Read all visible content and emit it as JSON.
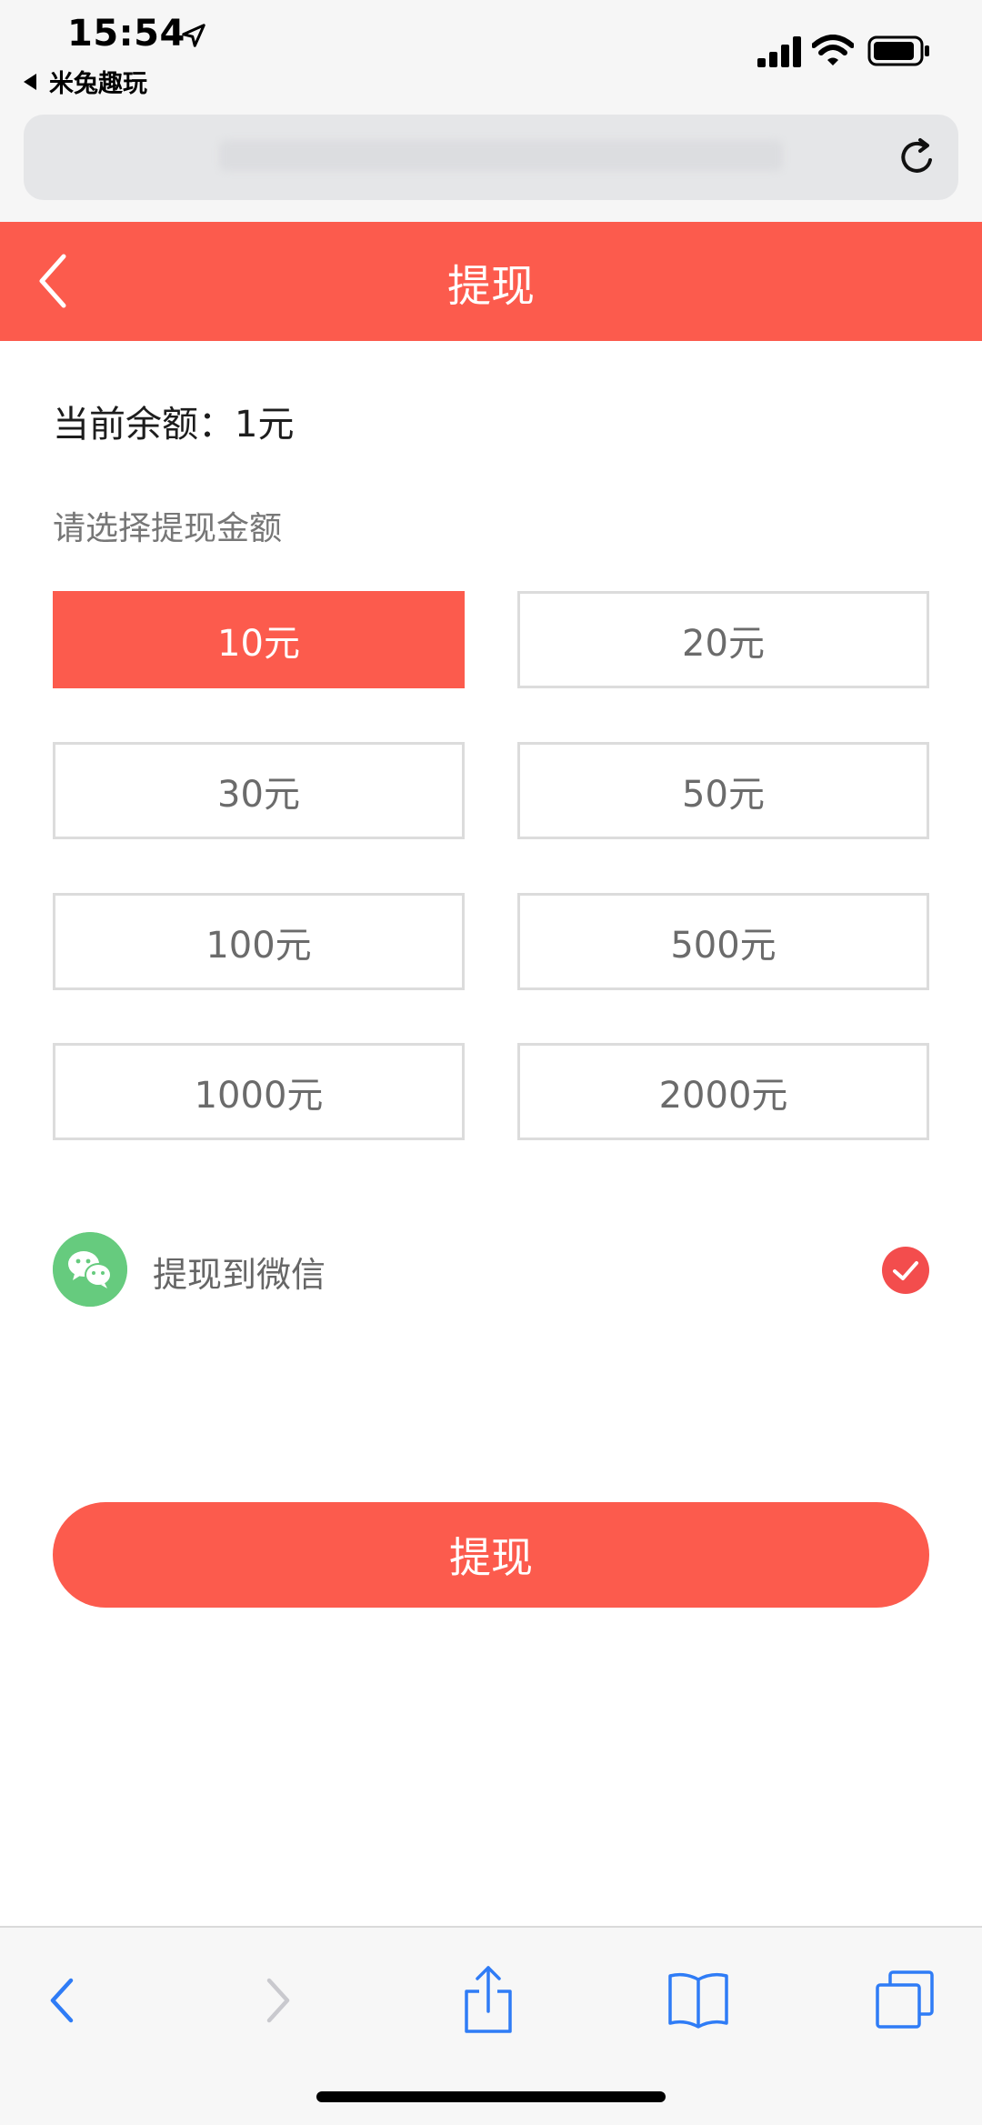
{
  "status_bar": {
    "time": "15:54",
    "back_app": "米兔趣玩"
  },
  "header": {
    "title": "提现"
  },
  "balance": {
    "text": "当前余额：1元"
  },
  "select_label": "请选择提现金额",
  "amounts": [
    {
      "label": "10元",
      "selected": true
    },
    {
      "label": "20元",
      "selected": false
    },
    {
      "label": "30元",
      "selected": false
    },
    {
      "label": "50元",
      "selected": false
    },
    {
      "label": "100元",
      "selected": false
    },
    {
      "label": "500元",
      "selected": false
    },
    {
      "label": "1000元",
      "selected": false
    },
    {
      "label": "2000元",
      "selected": false
    }
  ],
  "pay_method": {
    "label": "提现到微信",
    "icon": "wechat-icon",
    "checked": true
  },
  "submit_label": "提现",
  "colors": {
    "accent": "#fc5b4d",
    "wechat": "#66cb7e",
    "ios_blue": "#2f7cf6"
  },
  "toolbar_icons": [
    "back-icon",
    "forward-icon",
    "share-icon",
    "bookmarks-icon",
    "tabs-icon"
  ]
}
